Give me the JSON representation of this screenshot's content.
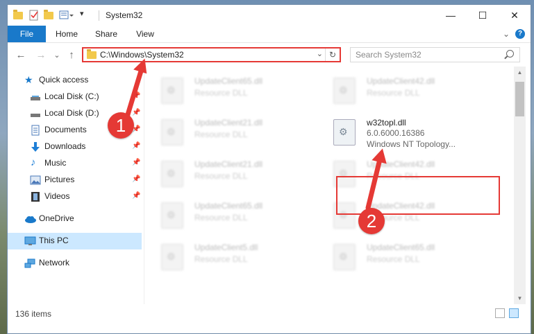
{
  "window": {
    "title": "System32",
    "controls": {
      "minimize": "—",
      "maximize": "☐",
      "close": "✕"
    }
  },
  "ribbon": {
    "tabs": [
      "File",
      "Home",
      "Share",
      "View"
    ],
    "help": "?"
  },
  "addressbar": {
    "path": "C:\\Windows\\System32",
    "refresh": "↻",
    "dropdown": "⌄"
  },
  "search": {
    "placeholder": "Search System32"
  },
  "nav": {
    "back": "←",
    "forward": "→",
    "recent": "⌄",
    "up": "↑",
    "items": [
      {
        "label": "Quick access",
        "icon": "star-icon",
        "color": "#1979ca"
      },
      {
        "label": "Local Disk (C:)",
        "icon": "drive-icon",
        "color": "#555555"
      },
      {
        "label": "Local Disk (D:)",
        "icon": "drive-icon",
        "color": "#555555"
      },
      {
        "label": "Documents",
        "icon": "documents-icon",
        "color": "#4a78b8"
      },
      {
        "label": "Downloads",
        "icon": "downloads-icon",
        "color": "#1f7fd6"
      },
      {
        "label": "Music",
        "icon": "music-icon",
        "color": "#1f7fd6"
      },
      {
        "label": "Pictures",
        "icon": "pictures-icon",
        "color": "#4a78b8"
      },
      {
        "label": "Videos",
        "icon": "videos-icon",
        "color": "#333333"
      },
      {
        "label": "OneDrive",
        "icon": "onedrive-icon",
        "color": "#1979ca"
      },
      {
        "label": "This PC",
        "icon": "pc-icon",
        "color": "#1979ca"
      },
      {
        "label": "Network",
        "icon": "network-icon",
        "color": "#1979ca"
      }
    ]
  },
  "files": [
    {
      "name": "UpdateClient65.dll",
      "desc": "Resource DLL"
    },
    {
      "name": "UpdateClient42.dll",
      "desc": "Resource DLL"
    },
    {
      "name": "UpdateClient21.dll",
      "desc": "Resource DLL"
    },
    {
      "name": "w32topl.dll",
      "version": "6.0.6000.16386",
      "desc": "Windows NT Topology..."
    },
    {
      "name": "UpdateClient21.dll",
      "desc": "Resource DLL"
    },
    {
      "name": "UpdateClient42.dll",
      "desc": "Resource DLL"
    },
    {
      "name": "UpdateClient65.dll",
      "desc": "Resource DLL"
    },
    {
      "name": "UpdateClient42.dll",
      "desc": "Resource DLL"
    },
    {
      "name": "UpdateClient5.dll",
      "desc": "Resource DLL"
    },
    {
      "name": "UpdateClient65.dll",
      "desc": "Resource DLL"
    }
  ],
  "status": {
    "count": "136 items"
  },
  "annotations": {
    "step1": "1",
    "step2": "2",
    "color": "#e53935"
  }
}
